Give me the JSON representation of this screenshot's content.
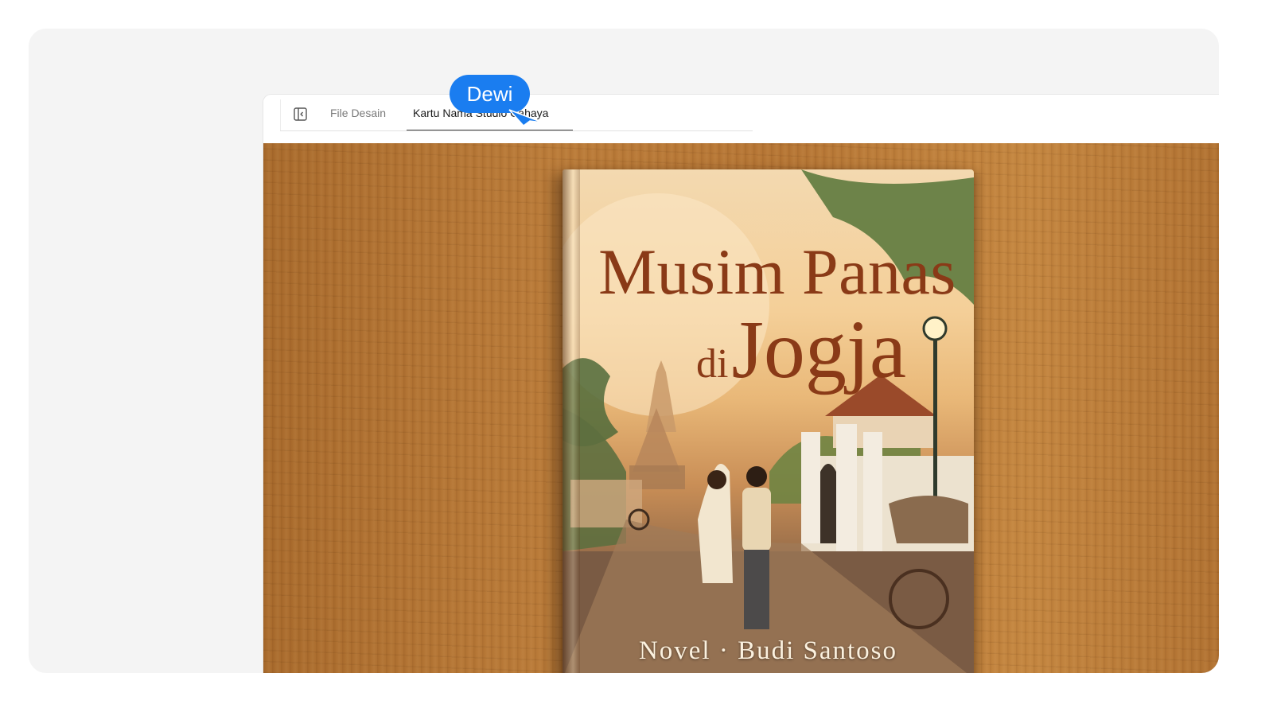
{
  "tabs": {
    "sidebar_toggle_icon": "sidebar-panel-icon",
    "items": [
      {
        "label": "File Desain",
        "active": false
      },
      {
        "label": "Kartu Nama Studio Cahaya",
        "active": true
      }
    ]
  },
  "book": {
    "title_line_1": "Musim Panas",
    "title_word_di": "di",
    "title_word_jogja": "Jogja",
    "author_line": "Novel · Budi Santoso"
  },
  "cursor": {
    "user_label": "Dewi",
    "color": "#1a7df0"
  },
  "colors": {
    "panel_background": "#f4f4f4",
    "wood": "#b57534",
    "title_color": "#8a3a17"
  }
}
